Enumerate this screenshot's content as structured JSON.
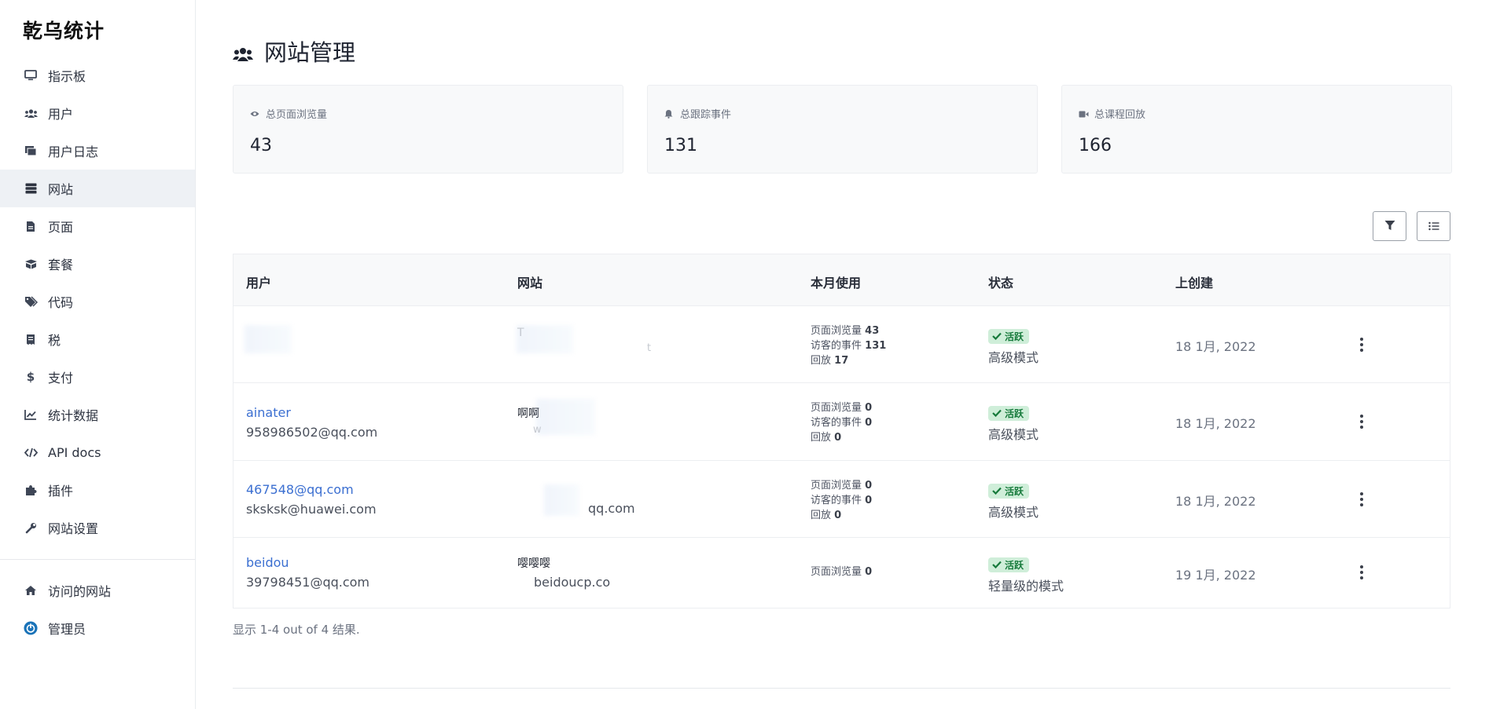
{
  "brand": "乾乌统计",
  "sidebar": {
    "items": [
      {
        "label": "指示板",
        "icon": "monitor-icon"
      },
      {
        "label": "用户",
        "icon": "users-icon"
      },
      {
        "label": "用户日志",
        "icon": "log-icon"
      },
      {
        "label": "网站",
        "icon": "server-icon",
        "active": true
      },
      {
        "label": "页面",
        "icon": "file-icon"
      },
      {
        "label": "套餐",
        "icon": "box-icon"
      },
      {
        "label": "代码",
        "icon": "tags-icon"
      },
      {
        "label": "税",
        "icon": "receipt-icon"
      },
      {
        "label": "支付",
        "icon": "dollar-icon"
      },
      {
        "label": "统计数据",
        "icon": "chart-icon"
      },
      {
        "label": "API docs",
        "icon": "code-icon"
      },
      {
        "label": "插件",
        "icon": "puzzle-icon"
      },
      {
        "label": "网站设置",
        "icon": "wrench-icon"
      }
    ],
    "bottom": [
      {
        "label": "访问的网站",
        "icon": "home-icon"
      },
      {
        "label": "管理员",
        "icon": "power-icon"
      }
    ]
  },
  "page": {
    "title": "网站管理"
  },
  "stats": [
    {
      "label": "总页面浏览量",
      "value": "43",
      "icon": "eye-icon"
    },
    {
      "label": "总跟踪事件",
      "value": "131",
      "icon": "bell-icon"
    },
    {
      "label": "总课程回放",
      "value": "166",
      "icon": "video-icon"
    }
  ],
  "table": {
    "headers": [
      "用户",
      "网站",
      "本月使用",
      "状态",
      "上创建"
    ],
    "rows": [
      {
        "user_name": "",
        "user_email": "",
        "site_name": "T",
        "site_url": "t",
        "usage": [
          {
            "label": "页面浏览量",
            "value": "43"
          },
          {
            "label": "访客的事件",
            "value": "131"
          },
          {
            "label": "回放",
            "value": "17"
          }
        ],
        "status": "活跃",
        "mode": "高级模式",
        "created": "18 1月, 2022"
      },
      {
        "user_name": "ainater",
        "user_email": "958986502@qq.com",
        "site_name": "啊啊",
        "site_url": "w",
        "usage": [
          {
            "label": "页面浏览量",
            "value": "0"
          },
          {
            "label": "访客的事件",
            "value": "0"
          },
          {
            "label": "回放",
            "value": "0"
          }
        ],
        "status": "活跃",
        "mode": "高级模式",
        "created": "18 1月, 2022"
      },
      {
        "user_name": "467548@qq.com",
        "user_email": "sksksk@huawei.com",
        "site_name": "",
        "site_url": "qq.com",
        "usage": [
          {
            "label": "页面浏览量",
            "value": "0"
          },
          {
            "label": "访客的事件",
            "value": "0"
          },
          {
            "label": "回放",
            "value": "0"
          }
        ],
        "status": "活跃",
        "mode": "高级模式",
        "created": "18 1月, 2022"
      },
      {
        "user_name": "beidou",
        "user_email": "39798451@qq.com",
        "site_name": "嘤嘤嘤",
        "site_url": "beidoucp.co",
        "usage": [
          {
            "label": "页面浏览量",
            "value": "0"
          }
        ],
        "status": "活跃",
        "mode": "轻量级的模式",
        "created": "19 1月, 2022"
      }
    ]
  },
  "results_text": "显示 1-4 out of 4 结果.",
  "colors": {
    "accent": "#3b6fd1",
    "badge_bg": "#cfeed9",
    "badge_text": "#167a3b"
  }
}
